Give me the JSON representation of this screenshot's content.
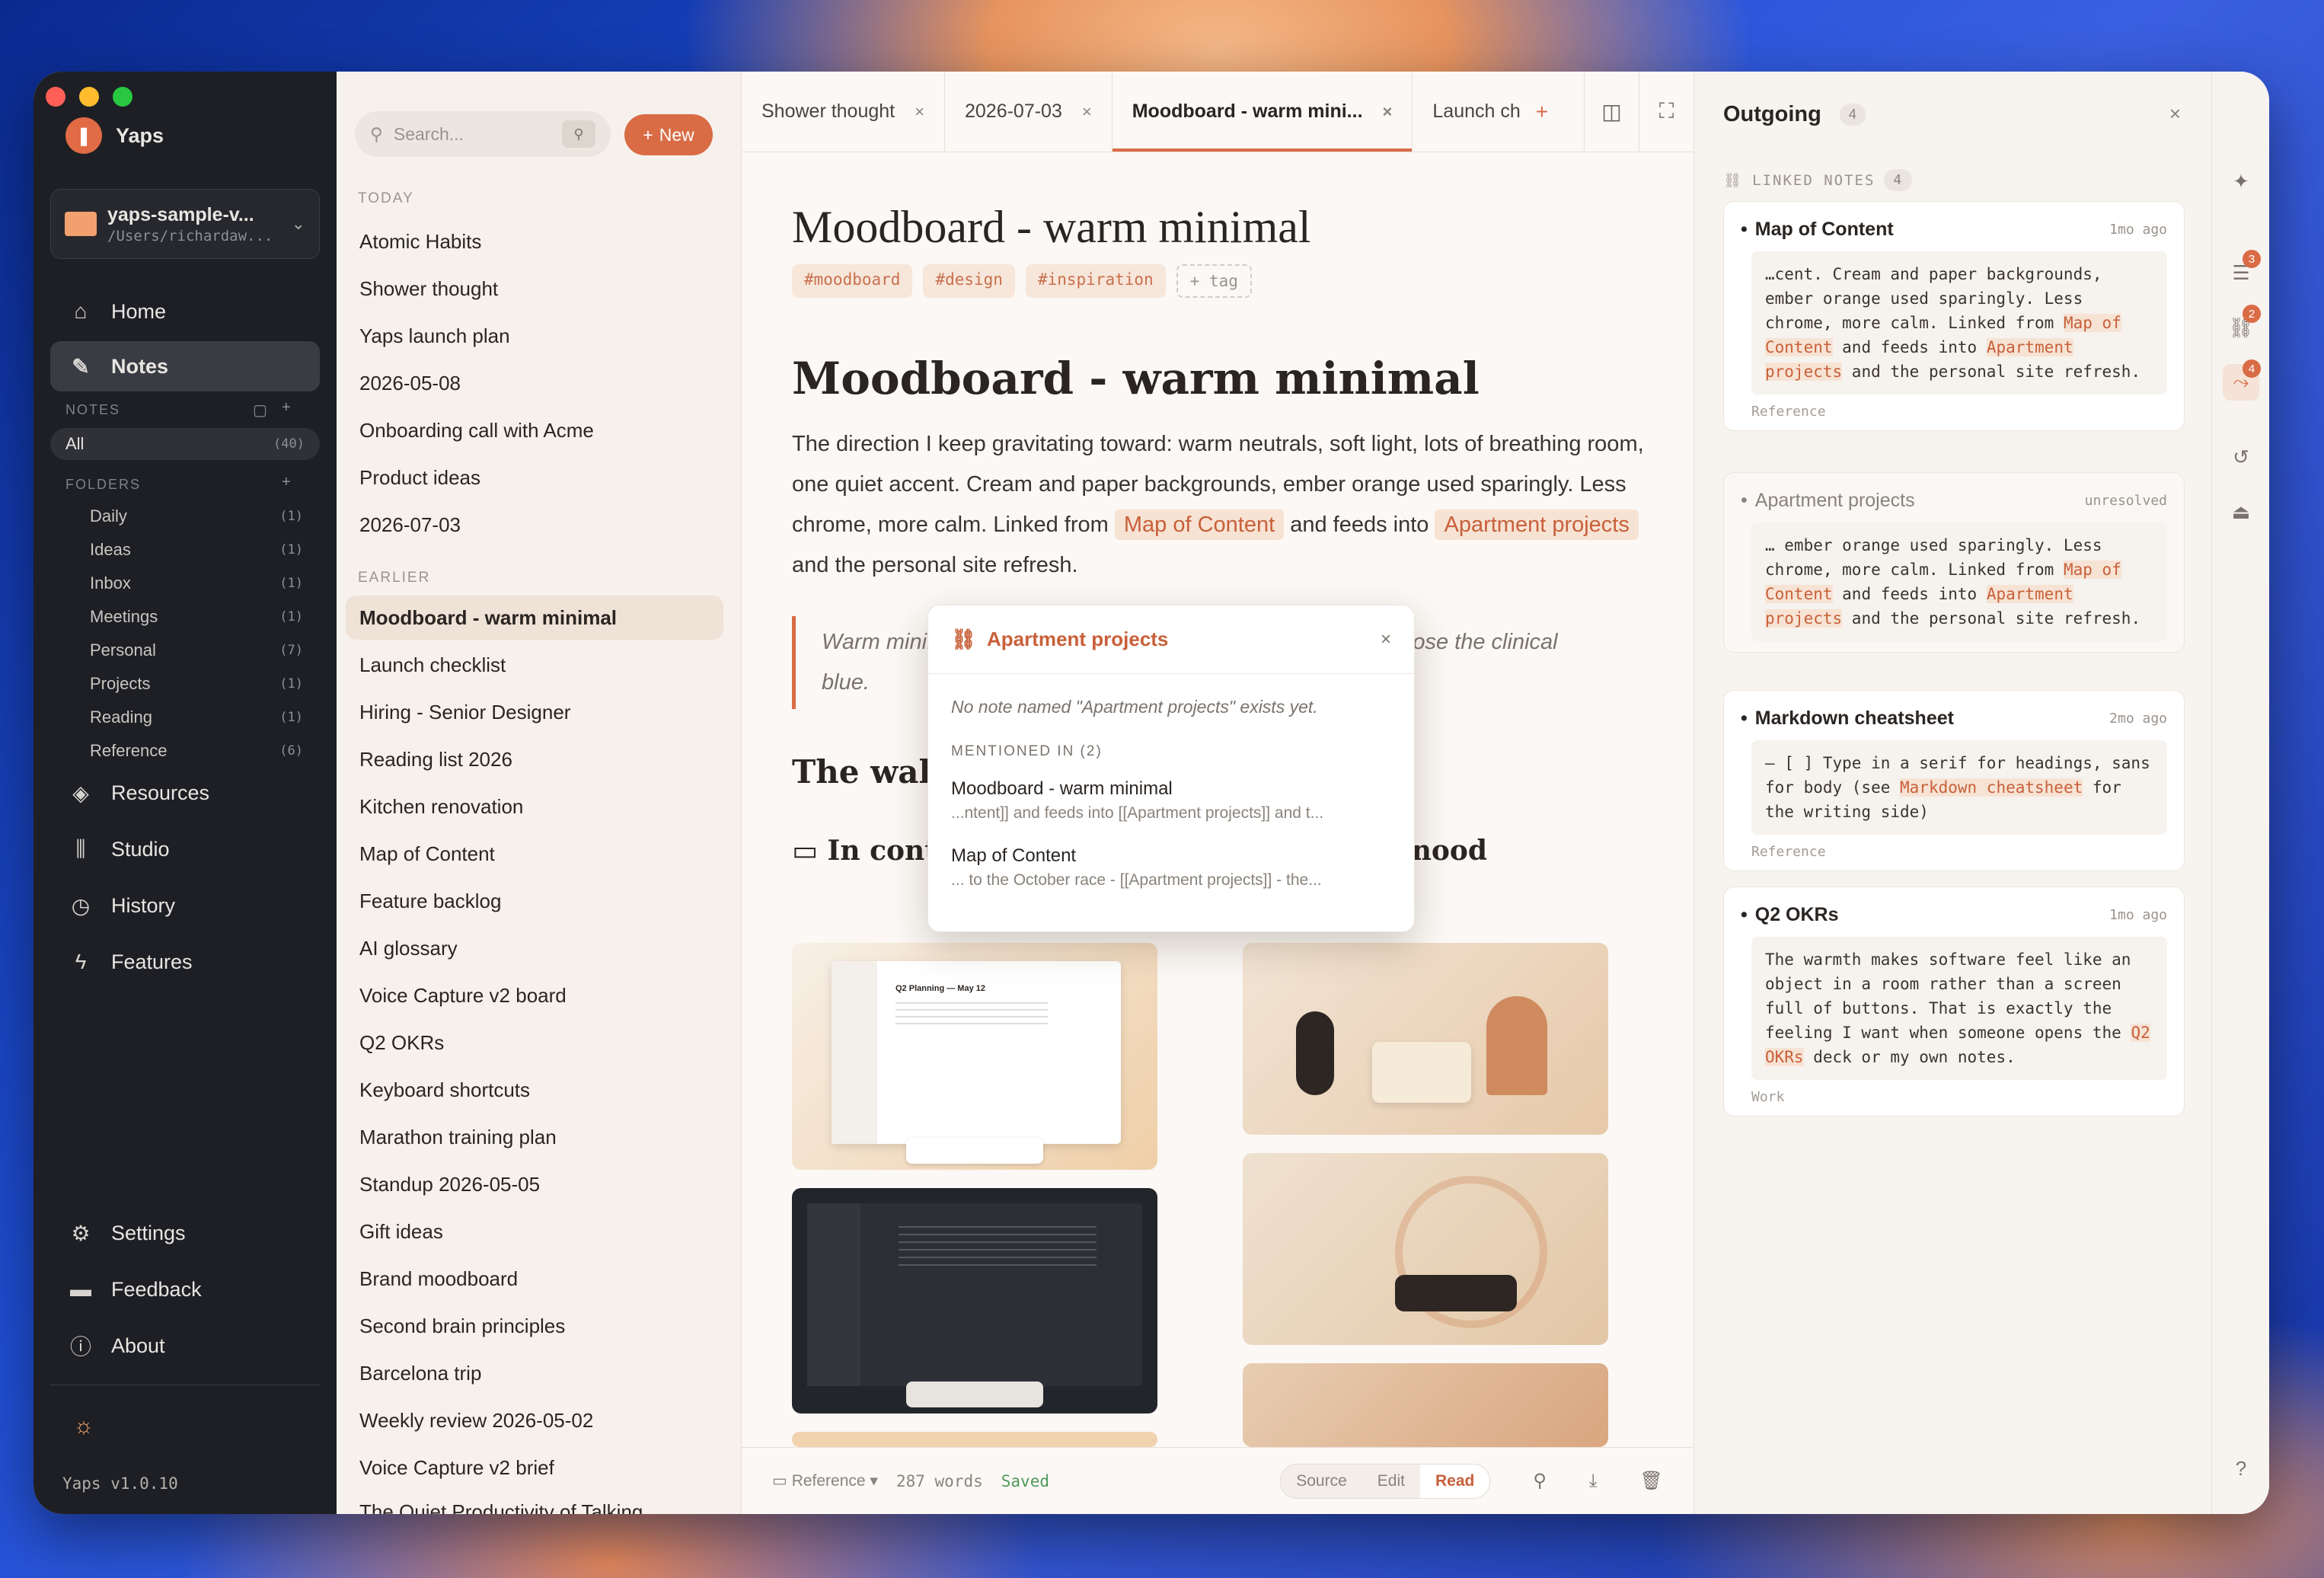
{
  "app": {
    "name": "Yaps",
    "version": "Yaps v1.0.10"
  },
  "vault": {
    "name": "yaps-sample-v...",
    "path": "/Users/richardaw..."
  },
  "nav": {
    "home": "Home",
    "notes": "Notes",
    "resources": "Resources",
    "studio": "Studio",
    "history": "History",
    "features": "Features",
    "settings": "Settings",
    "feedback": "Feedback",
    "about": "About"
  },
  "sidebar": {
    "notes_section": "NOTES",
    "all": "All",
    "all_count": "(40)",
    "folders_section": "FOLDERS",
    "folders": [
      {
        "name": "Daily",
        "count": "(1)"
      },
      {
        "name": "Ideas",
        "count": "(1)"
      },
      {
        "name": "Inbox",
        "count": "(1)"
      },
      {
        "name": "Meetings",
        "count": "(1)"
      },
      {
        "name": "Personal",
        "count": "(7)"
      },
      {
        "name": "Projects",
        "count": "(1)"
      },
      {
        "name": "Reading",
        "count": "(1)"
      },
      {
        "name": "Reference",
        "count": "(6)"
      }
    ]
  },
  "list": {
    "search_placeholder": "Search...",
    "new_label": "New",
    "today": "TODAY",
    "earlier": "EARLIER",
    "today_items": [
      "Atomic Habits",
      "Shower thought",
      "Yaps launch plan",
      "2026-05-08",
      "Onboarding call with Acme",
      "Product ideas",
      "2026-07-03"
    ],
    "earlier_items": [
      "Moodboard - warm minimal",
      "Launch checklist",
      "Hiring - Senior Designer",
      "Reading list 2026",
      "Kitchen renovation",
      "Map of Content",
      "Feature backlog",
      "AI glossary",
      "Voice Capture v2 board",
      "Q2 OKRs",
      "Keyboard shortcuts",
      "Marathon training plan",
      "Standup 2026-05-05",
      "Gift ideas",
      "Brand moodboard",
      "Second brain principles",
      "Barcelona trip",
      "Weekly review 2026-05-02",
      "Voice Capture v2 brief",
      "The Quiet Productivity of Talking"
    ]
  },
  "tabs": [
    {
      "label": "Shower thought"
    },
    {
      "label": "2026-07-03"
    },
    {
      "label": "Moodboard - warm mini..."
    },
    {
      "label": "Launch ch"
    }
  ],
  "doc": {
    "title": "Moodboard - warm minimal",
    "tags": [
      "#moodboard",
      "#design",
      "#inspiration"
    ],
    "add_tag": "+ tag",
    "h1": "Moodboard - warm minimal",
    "p1a": "The direction I keep gravitating toward: warm neutrals, soft light, lots of breathing room, one quiet accent. Cream and paper backgrounds, ember orange used sparingly. Less chrome, more calm. Linked from ",
    "link1": "Map of Content",
    "p1b": " and feeds into ",
    "link2": "Apartment projects",
    "p1c": " and the personal site refresh.",
    "quote_a": "Warm minir",
    "quote_b": "e, lose the clinical",
    "quote_c": "blue.",
    "h2": "The wall",
    "h3a": "In conte",
    "h3b": "nood",
    "mock1_title": "Q2 Planning — May 12"
  },
  "popup": {
    "title": "Apartment projects",
    "empty": "No note named \"Apartment projects\" exists yet.",
    "mentioned": "MENTIONED IN (2)",
    "mentions": [
      {
        "title": "Moodboard - warm minimal",
        "snippet": "...ntent]] and feeds into [[Apartment projects]] and t..."
      },
      {
        "title": "Map of Content",
        "snippet": "... to the October race - [[Apartment projects]] - the..."
      }
    ]
  },
  "footer": {
    "folder": "Reference",
    "words": "287 words",
    "saved": "Saved",
    "modes": [
      "Source",
      "Edit",
      "Read"
    ]
  },
  "panel": {
    "title": "Outgoing",
    "count": "4",
    "linked": "LINKED NOTES",
    "linked_count": "4",
    "cards": [
      {
        "title": "Map of Content",
        "age": "1mo ago",
        "footer": "Reference"
      },
      {
        "title": "Apartment projects",
        "age": "unresolved",
        "footer": ""
      },
      {
        "title": "Markdown cheatsheet",
        "age": "2mo ago",
        "footer": "Reference"
      },
      {
        "title": "Q2 OKRs",
        "age": "1mo ago",
        "footer": "Work"
      }
    ],
    "c1": [
      "…cent. Cream and paper backgrounds, ember orange used sparingly. Less chrome, more calm. Linked from ",
      "Map of Content",
      " and feeds into ",
      "Apartment projects",
      " and the personal site refresh."
    ],
    "c2": [
      "… ember orange used sparingly. Less chrome, more calm. Linked from ",
      "Map of Content",
      " and feeds into ",
      "Apartment projects",
      " and the personal site refresh."
    ],
    "c3": [
      "– [ ] Type in a serif for headings, sans for body (see ",
      "Markdown cheatsheet",
      " for the writing side)"
    ],
    "c4": [
      "The warmth makes software feel like an object in a room rather than a screen full of buttons. That is exactly the feeling I want when someone opens the ",
      "Q2 OKRs",
      " deck or my own notes."
    ]
  },
  "rail": {
    "badges": [
      "3",
      "2",
      "4"
    ],
    "help": "?"
  },
  "colors": {
    "accent": "#d96b45",
    "sidebar": "#1d1f24",
    "paper": "#fbf8f5"
  }
}
